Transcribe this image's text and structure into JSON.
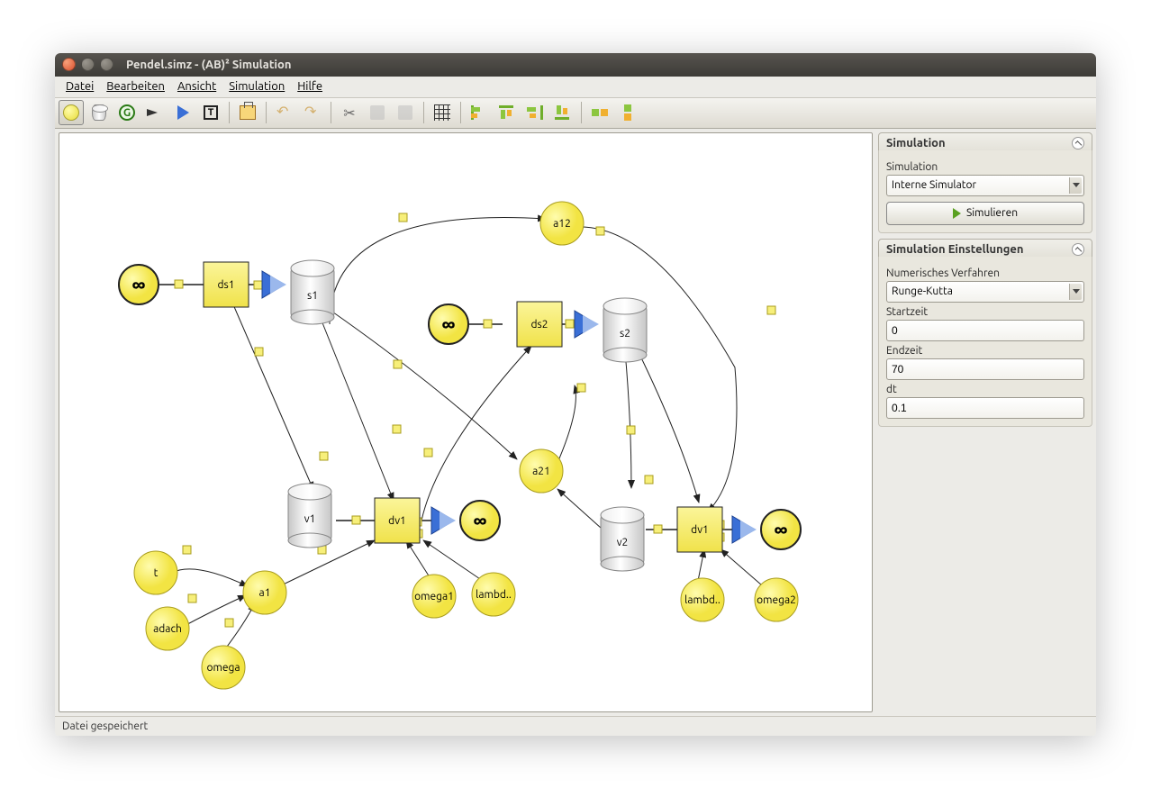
{
  "window": {
    "title": "Pendel.simz - (AB)² Simulation"
  },
  "menubar": {
    "items": [
      "Datei",
      "Bearbeiten",
      "Ansicht",
      "Simulation",
      "Hilfe"
    ]
  },
  "sidebar": {
    "simulation": {
      "header": "Simulation",
      "sim_label": "Simulation",
      "sim_selected": "Interne Simulator",
      "simulate_btn": "Simulieren"
    },
    "settings": {
      "header": "Simulation Einstellungen",
      "method_label": "Numerisches Verfahren",
      "method_selected": "Runge-Kutta",
      "start_label": "Startzeit",
      "start_value": "0",
      "end_label": "Endzeit",
      "end_value": "70",
      "dt_label": "dt",
      "dt_value": "0.1"
    }
  },
  "statusbar": {
    "text": "Datei gespeichert"
  },
  "nodes": {
    "ds1": "ds1",
    "s1": "s1",
    "a12": "a12",
    "ds2": "ds2",
    "s2": "s2",
    "a21": "a21",
    "v1": "v1",
    "dv1": "dv1",
    "v2": "v2",
    "dv2": "dv1",
    "t": "t",
    "a1": "a1",
    "adach": "adach",
    "omega": "omega",
    "omega1": "omega1",
    "lambda1": "lambd..",
    "lambda2": "lambd..",
    "omega2": "omega2"
  }
}
